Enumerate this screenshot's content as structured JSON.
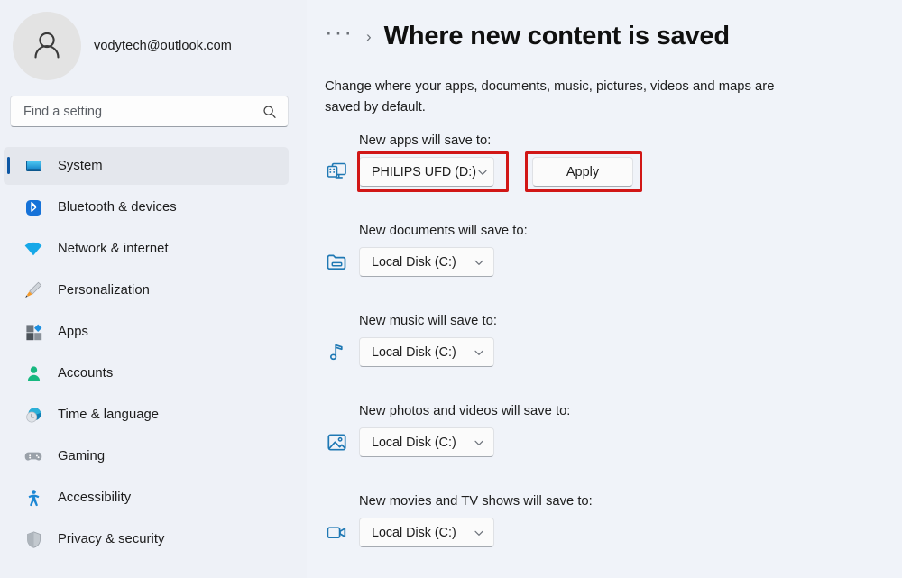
{
  "account": {
    "email": "vodytech@outlook.com",
    "avatar_icon": "person-avatar-icon"
  },
  "search": {
    "placeholder": "Find a setting",
    "value": "",
    "icon": "search-icon"
  },
  "sidebar": {
    "items": [
      {
        "label": "System",
        "icon": "monitor-icon",
        "selected": true
      },
      {
        "label": "Bluetooth & devices",
        "icon": "bluetooth-icon",
        "selected": false
      },
      {
        "label": "Network & internet",
        "icon": "wifi-icon",
        "selected": false
      },
      {
        "label": "Personalization",
        "icon": "paintbrush-icon",
        "selected": false
      },
      {
        "label": "Apps",
        "icon": "apps-icon",
        "selected": false
      },
      {
        "label": "Accounts",
        "icon": "person-icon",
        "selected": false
      },
      {
        "label": "Time & language",
        "icon": "clock-globe-icon",
        "selected": false
      },
      {
        "label": "Gaming",
        "icon": "gamepad-icon",
        "selected": false
      },
      {
        "label": "Accessibility",
        "icon": "accessibility-icon",
        "selected": false
      },
      {
        "label": "Privacy & security",
        "icon": "shield-icon",
        "selected": false
      }
    ]
  },
  "header": {
    "breadcrumb_overflow": "···",
    "breadcrumb_separator": "›",
    "title": "Where new content is saved"
  },
  "main": {
    "description": "Change where your apps, documents, music, pictures, videos and maps are saved by default.",
    "apply_label": "Apply",
    "rows": [
      {
        "label": "New apps will save to:",
        "icon": "apps-monitor-icon",
        "value": "PHILIPS UFD (D:)",
        "has_apply": true,
        "highlighted": true
      },
      {
        "label": "New documents will save to:",
        "icon": "documents-folder-icon",
        "value": "Local Disk (C:)",
        "has_apply": false,
        "highlighted": false
      },
      {
        "label": "New music will save to:",
        "icon": "music-note-icon",
        "value": "Local Disk (C:)",
        "has_apply": false,
        "highlighted": false
      },
      {
        "label": "New photos and videos will save to:",
        "icon": "photo-icon",
        "value": "Local Disk (C:)",
        "has_apply": false,
        "highlighted": false
      },
      {
        "label": "New movies and TV shows will save to:",
        "icon": "video-camera-icon",
        "value": "Local Disk (C:)",
        "has_apply": false,
        "highlighted": false
      }
    ]
  },
  "colors": {
    "accent": "#0d57a4",
    "annotation_red": "#d11616",
    "sidebar_bg": "#eef1f7",
    "content_bg": "#f0f3f9",
    "selected_bg": "#e4e7ed"
  }
}
